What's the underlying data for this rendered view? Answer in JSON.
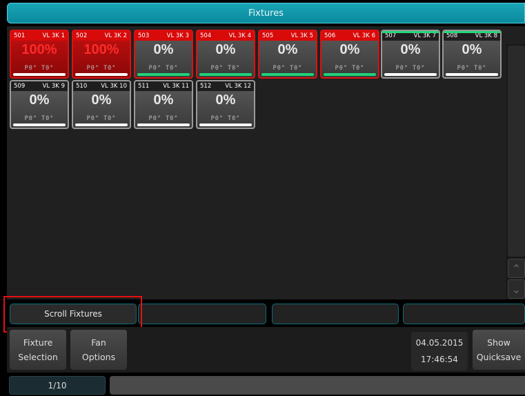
{
  "window": {
    "title": "Fixtures"
  },
  "fixtures": [
    {
      "id": "501",
      "name": "VL 3K 1",
      "value": "100%",
      "pan": "P0°",
      "tilt": "T0°",
      "state": "selected",
      "bar": "white"
    },
    {
      "id": "502",
      "name": "VL 3K 2",
      "value": "100%",
      "pan": "P0°",
      "tilt": "T0°",
      "state": "selected",
      "bar": "white"
    },
    {
      "id": "503",
      "name": "VL 3K 3",
      "value": "0%",
      "pan": "P0°",
      "tilt": "T0°",
      "state": "selected",
      "bar": "green"
    },
    {
      "id": "504",
      "name": "VL 3K 4",
      "value": "0%",
      "pan": "P0°",
      "tilt": "T0°",
      "state": "selected",
      "bar": "green"
    },
    {
      "id": "505",
      "name": "VL 3K 5",
      "value": "0%",
      "pan": "P0°",
      "tilt": "T0°",
      "state": "selected",
      "bar": "green"
    },
    {
      "id": "506",
      "name": "VL 3K 6",
      "value": "0%",
      "pan": "P0°",
      "tilt": "T0°",
      "state": "selected",
      "bar": "green"
    },
    {
      "id": "507",
      "name": "VL 3K 7",
      "value": "0%",
      "pan": "P0°",
      "tilt": "T0°",
      "state": "normal-green",
      "bar": "white"
    },
    {
      "id": "508",
      "name": "VL 3K 8",
      "value": "0%",
      "pan": "P0°",
      "tilt": "T0°",
      "state": "normal-green",
      "bar": "white"
    },
    {
      "id": "509",
      "name": "VL 3K 9",
      "value": "0%",
      "pan": "P0°",
      "tilt": "T0°",
      "state": "normal",
      "bar": "white"
    },
    {
      "id": "510",
      "name": "VL 3K 10",
      "value": "0%",
      "pan": "P0°",
      "tilt": "T0°",
      "state": "normal",
      "bar": "white"
    },
    {
      "id": "511",
      "name": "VL 3K 11",
      "value": "0%",
      "pan": "P0°",
      "tilt": "T0°",
      "state": "normal",
      "bar": "white"
    },
    {
      "id": "512",
      "name": "VL 3K 12",
      "value": "0%",
      "pan": "P0°",
      "tilt": "T0°",
      "state": "normal",
      "bar": "white"
    }
  ],
  "scroll": {
    "up_icon": "chevron-up-icon",
    "down_icon": "chevron-down-icon"
  },
  "command_row": {
    "scroll_fixtures": "Scroll Fixtures"
  },
  "softkeys": {
    "fixture_selection": [
      "Fixture",
      "Selection"
    ],
    "fan_options": [
      "Fan",
      "Options"
    ],
    "show_quicksave": [
      "Show",
      "Quicksave"
    ]
  },
  "clock": {
    "date": "04.05.2015",
    "time": "17:46:54"
  },
  "pagination": {
    "label": "1/10"
  },
  "colors": {
    "accent": "#0a8a9c",
    "selected": "#d80a0a",
    "intensity_green": "#20d278"
  }
}
